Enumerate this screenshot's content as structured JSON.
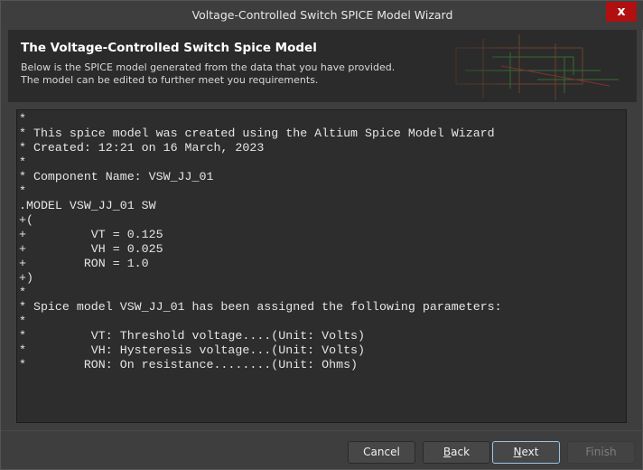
{
  "window": {
    "title": "Voltage-Controlled Switch SPICE Model Wizard",
    "close_label": "x"
  },
  "header": {
    "title": "The Voltage-Controlled Switch Spice Model",
    "description": "Below is the SPICE model generated from the data that you have provided. The model can be edited to further meet you requirements."
  },
  "model_text": "*\n* This spice model was created using the Altium Spice Model Wizard\n* Created: 12:21 on 16 March, 2023\n*\n* Component Name: VSW_JJ_01\n*\n.MODEL VSW_JJ_01 SW\n+(\n+         VT = 0.125\n+         VH = 0.025\n+        RON = 1.0\n+)\n*\n* Spice model VSW_JJ_01 has been assigned the following parameters:\n*\n*         VT: Threshold voltage....(Unit: Volts)\n*         VH: Hysteresis voltage...(Unit: Volts)\n*        RON: On resistance........(Unit: Ohms)",
  "buttons": {
    "cancel": "Cancel",
    "back_first": "B",
    "back_rest": "ack",
    "next_first": "N",
    "next_rest": "ext",
    "finish": "Finish"
  }
}
